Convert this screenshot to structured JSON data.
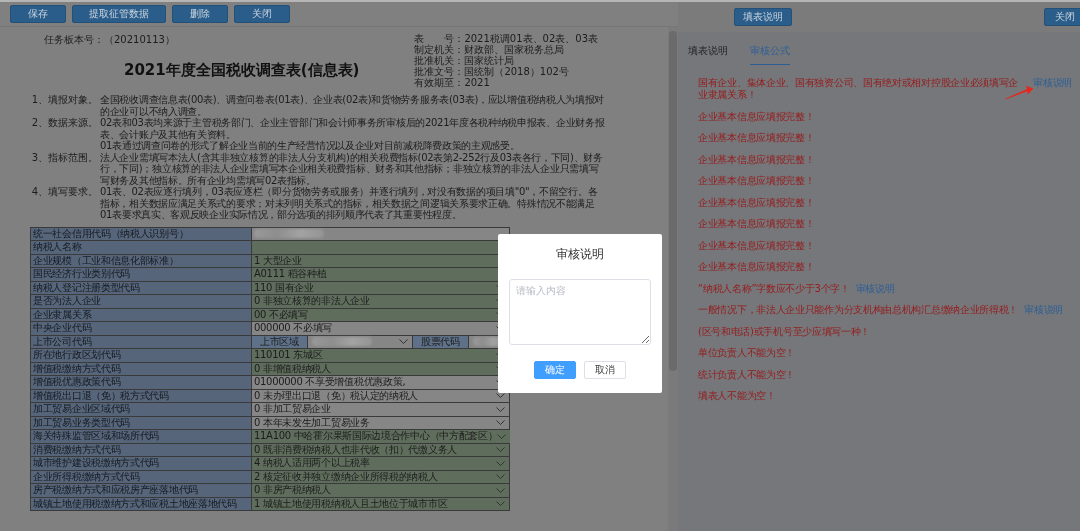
{
  "left_toolbar": {
    "buttons": [
      "保存",
      "提取征管数据",
      "删除",
      "关闭"
    ]
  },
  "right_toolbar": {
    "buttons": [
      "填表说明",
      "关闭"
    ]
  },
  "form_header": {
    "task_version": "任务板本号：（20210113）",
    "title": "2021年度全国税收调查表(信息表)",
    "info_lines": [
      "表　　号：2021税调01表、02表、03表",
      "制定机关：财政部、国家税务总局",
      "批准机关：国家统计局",
      "批准文号：国统制（2018）102号",
      "有效期至：2021"
    ]
  },
  "instructions": [
    {
      "label": "1、填报对象。",
      "lines": [
        "全国税收调查信息表(00表)、调查问卷表(01表)、企业表(02表)和货物劳务服务表(03表)，应以增值税纳税人为填报对",
        "的企业可以不纳入调查。"
      ]
    },
    {
      "label": "2、数据来源。",
      "lines": [
        "02表和03表均来源于主管税务部门、企业主管部门和会计师事务所审核后的2021年度各税种纳税申报表、企业财务报",
        "表、会计账户及其他有关资料。",
        "01表通过调查问卷的形式了解企业当前的生产经营情况以及企业对目前减税降费政策的主观感受。"
      ]
    },
    {
      "label": "3、指标范围。",
      "lines": [
        "法人企业需填写本法人(含其非独立核算的非法人分支机构)的相关税费指标(02表第2-252行及03表各行，下同)、财务",
        "行，下同)；独立核算的非法人企业需填写本企业相关税费指标、财务和其他指标；非独立核算的非法人企业只需填写",
        "写财务及其他指标。所有企业均需填写02表指标。"
      ]
    },
    {
      "label": "4、填写要求。",
      "lines": [
        "01表、02表应逐行填列，03表应逐栏（即分货物劳务或服务）并逐行填列，对没有数据的项目填\"0\"，不留空行。各",
        "指标，相关数据应满足关系式的要求；对未列明关系式的指标，相关数据之间逻辑关系要求正确。特殊情况不能满足",
        "01表要求真实、客观反映企业实际情况，部分选项的排列顺序代表了其重要性程度。"
      ]
    }
  ],
  "table": {
    "rows": [
      {
        "label": "统一社会信用代码（纳税人识别号）",
        "kind": "redacted",
        "highlighted": false
      },
      {
        "label": "纳税人名称",
        "kind": "text",
        "highlighted": true
      },
      {
        "label": "企业规模（工业和信息化部标准）",
        "value": "1 大型企业",
        "kind": "text",
        "highlighted": true
      },
      {
        "label": "国民经济行业类别代码",
        "value": "A0111 稻谷种植",
        "kind": "text",
        "highlighted": true
      },
      {
        "label": "纳税人登记注册类型代码",
        "value": "110 国有企业",
        "kind": "select",
        "highlighted": true
      },
      {
        "label": "是否为法人企业",
        "value": "0 非独立核算的非法人企业",
        "kind": "select",
        "highlighted": true
      },
      {
        "label": "企业隶属关系",
        "value": "00 不必填写",
        "kind": "select",
        "highlighted": true
      },
      {
        "label": "中央企业代码",
        "value": "000000 不必填写",
        "kind": "select",
        "highlighted": false
      },
      {
        "label": "上市公司代码",
        "kind": "stock",
        "region_label": "上市区域",
        "code_label": "股票代码",
        "highlighted": false
      },
      {
        "label": "所在地行政区划代码",
        "value": "110101 东城区",
        "kind": "select",
        "highlighted": true
      },
      {
        "label": "增值税缴纳方式代码",
        "value": "0 非增值税纳税人",
        "kind": "select",
        "highlighted": true
      },
      {
        "label": "增值税优惠政策代码",
        "value": "01000000 不享受增值税优惠政策,",
        "kind": "select",
        "highlighted": false
      },
      {
        "label": "增值税出口退（免）税方式代码",
        "value": "0 未办理出口退（免）税认定的纳税人",
        "kind": "select",
        "highlighted": false
      },
      {
        "label": "加工贸易企业区域代码",
        "value": "0 非加工贸易企业",
        "kind": "select",
        "highlighted": false
      },
      {
        "label": "加工贸易业务类型代码",
        "value": "0 本年未发生加工贸易业务",
        "kind": "select",
        "highlighted": false
      },
      {
        "label": "海关特殊监管区域和场所代码",
        "value": "11A100 中哈霍尔果斯国际边境合作中心（中方配套区）",
        "kind": "select",
        "highlighted": true
      },
      {
        "label": "消费税缴纳方式代码",
        "value": "0 既非消费税纳税人也非代收（扣）代缴义务人",
        "kind": "select",
        "highlighted": true
      },
      {
        "label": "城市维护建设税缴纳方式代码",
        "value": "4 纳税人适用两个以上税率",
        "kind": "select",
        "highlighted": true
      },
      {
        "label": "企业所得税缴纳方式代码",
        "value": "2 核定征收并独立缴纳企业所得税的纳税人",
        "kind": "select",
        "highlighted": true
      },
      {
        "label": "房产税缴纳方式和应税房产座落地代码",
        "value": "0 非房产税纳税人",
        "kind": "select",
        "highlighted": true
      },
      {
        "label": "城镇土地使用税缴纳方式和应税土地座落地代码",
        "value": "1 城镇土地使用税纳税人且土地位于城市市区",
        "kind": "select",
        "highlighted": true
      }
    ]
  },
  "right_panel": {
    "tabs": [
      {
        "label": "填表说明",
        "selected": false
      },
      {
        "label": "审核公式",
        "selected": true
      }
    ],
    "messages": [
      {
        "text": "国有企业、集体企业、国有独资公司、国有绝对或相对控股企业必须填写企业隶属关系！",
        "link": "审核说明",
        "pointer_arrow": true
      },
      {
        "text": "企业基本信息应填报完整！"
      },
      {
        "text": "企业基本信息应填报完整！"
      },
      {
        "text": "企业基本信息应填报完整！"
      },
      {
        "text": "企业基本信息应填报完整！"
      },
      {
        "text": "企业基本信息应填报完整！"
      },
      {
        "text": "企业基本信息应填报完整！"
      },
      {
        "text": "企业基本信息应填报完整！"
      },
      {
        "text": "企业基本信息应填报完整！"
      },
      {
        "text": "“纳税人名称”字数应不少于3个字！",
        "link": "审核说明"
      },
      {
        "text": "一般情况下，非法人企业只能作为分支机构由总机构汇总缴纳企业所得税！",
        "link": "审核说明"
      },
      {
        "text": "(区号和电话)或手机号至少应填写一种！"
      },
      {
        "text": "单位负责人不能为空！"
      },
      {
        "text": "统计负责人不能为空！"
      },
      {
        "text": "填表人不能为空！"
      }
    ]
  },
  "dialog": {
    "title": "审核说明",
    "placeholder": "请输入内容",
    "buttons": [
      {
        "label": "确定",
        "kind": "primary"
      },
      {
        "label": "取消",
        "kind": "default"
      }
    ]
  }
}
